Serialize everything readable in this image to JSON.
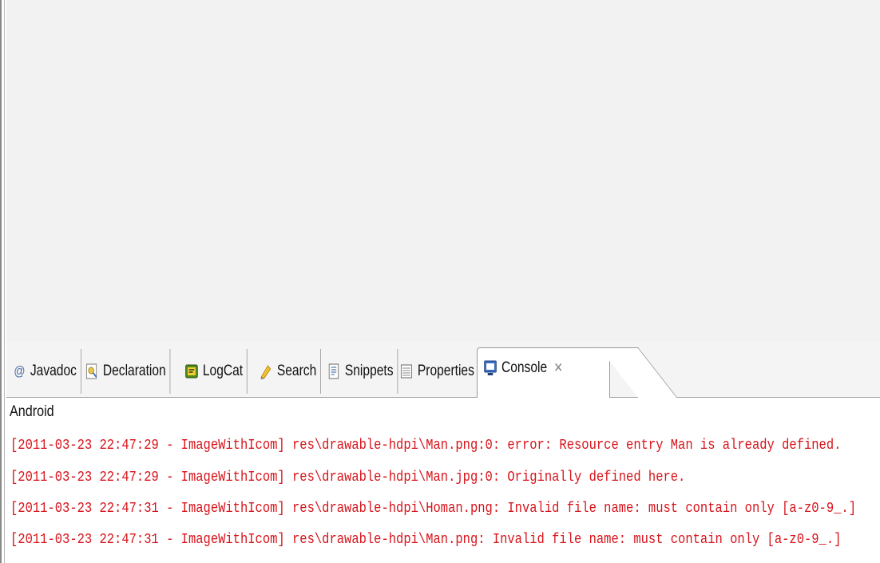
{
  "tabs": [
    {
      "label": "Javadoc",
      "icon": "at-icon"
    },
    {
      "label": "Declaration",
      "icon": "declaration-icon"
    },
    {
      "label": "LogCat",
      "icon": "logcat-icon"
    },
    {
      "label": "Search",
      "icon": "search-icon"
    },
    {
      "label": "Snippets",
      "icon": "snippets-icon"
    },
    {
      "label": "Properties",
      "icon": "properties-icon"
    },
    {
      "label": "Console",
      "icon": "console-icon",
      "active": true
    }
  ],
  "console": {
    "title": "Android",
    "lines": [
      "[2011-03-23 22:47:29 - ImageWithIcom] res\\drawable-hdpi\\Man.png:0: error: Resource entry Man is already defined.",
      "[2011-03-23 22:47:29 - ImageWithIcom] res\\drawable-hdpi\\Man.jpg:0: Originally defined here.",
      "[2011-03-23 22:47:31 - ImageWithIcom] res\\drawable-hdpi\\Homan.png: Invalid file name: must contain only [a-z0-9_.]",
      "[2011-03-23 22:47:31 - ImageWithIcom] res\\drawable-hdpi\\Man.png: Invalid file name: must contain only [a-z0-9_.]"
    ]
  },
  "colors": {
    "error_text": "#d7141b"
  }
}
